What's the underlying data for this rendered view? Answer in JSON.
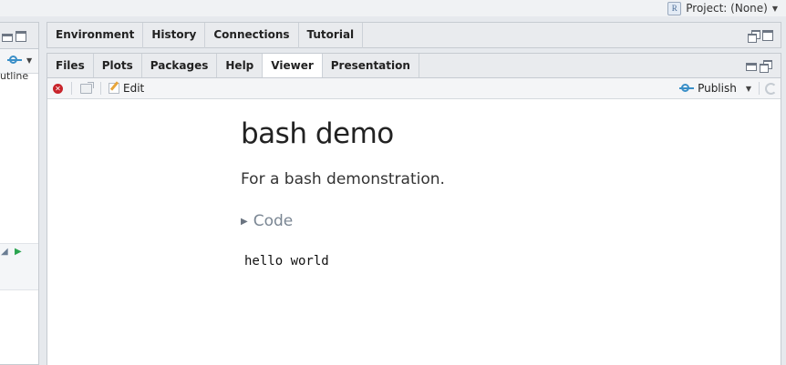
{
  "topbar": {
    "project_label": "Project: (None)",
    "project_icon_letter": "R"
  },
  "left_pane": {
    "outline_label": "utline"
  },
  "env_pane": {
    "tabs": [
      "Environment",
      "History",
      "Connections",
      "Tutorial"
    ]
  },
  "viewer_pane": {
    "tabs": [
      "Files",
      "Plots",
      "Packages",
      "Help",
      "Viewer",
      "Presentation"
    ],
    "active_tab": "Viewer",
    "toolbar": {
      "edit_label": "Edit",
      "publish_label": "Publish"
    }
  },
  "document": {
    "title": "bash demo",
    "subtitle": "For a bash demonstration.",
    "code_toggle_label": "Code",
    "output": "hello world"
  },
  "colors": {
    "accent": "#3a8fc8",
    "stop": "#c8242b",
    "run_chunk": "#2aa44f"
  }
}
